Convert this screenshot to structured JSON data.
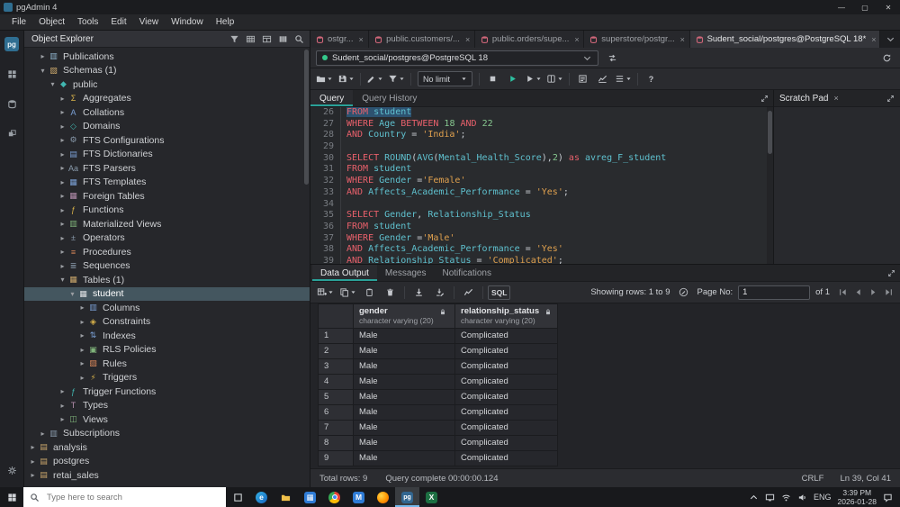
{
  "colors": {
    "accent": "#2aa198",
    "selection": "#2d5270",
    "keyword": "#e8606b",
    "identifier": "#5fc1cf",
    "string": "#dfa04e",
    "number": "#86c78f"
  },
  "titlebar": {
    "title": "pgAdmin 4",
    "minimize": "—",
    "maximize": "▢",
    "close": "✕"
  },
  "menubar": {
    "items": [
      "File",
      "Object",
      "Tools",
      "Edit",
      "View",
      "Window",
      "Help"
    ]
  },
  "iconstrip": {
    "top": [
      "pgadmin-logo",
      "dashboard-icon",
      "database-icon",
      "extensions-icon"
    ],
    "bottom": [
      "gear-icon"
    ]
  },
  "explorer": {
    "title": "Object Explorer",
    "tools": [
      "filter-icon",
      "grid-icon",
      "table-icon",
      "columns-icon",
      "search-icon"
    ],
    "tree": [
      {
        "label": "Publications",
        "level": 3,
        "state": "c",
        "glyph": "▥",
        "color": "#8fb4cc"
      },
      {
        "label": "Schemas (1)",
        "level": 3,
        "state": "e",
        "glyph": "▧",
        "color": "#c9a66b"
      },
      {
        "label": "public",
        "level": 4,
        "state": "e",
        "glyph": "◆",
        "color": "#41b6b0"
      },
      {
        "label": "Aggregates",
        "level": 5,
        "state": "c",
        "glyph": "Σ",
        "color": "#d8b24a"
      },
      {
        "label": "Collations",
        "level": 5,
        "state": "c",
        "glyph": "A",
        "color": "#7a9fd4"
      },
      {
        "label": "Domains",
        "level": 5,
        "state": "c",
        "glyph": "◇",
        "color": "#41b6b0"
      },
      {
        "label": "FTS Configurations",
        "level": 5,
        "state": "c",
        "glyph": "⚙",
        "color": "#8a9bac"
      },
      {
        "label": "FTS Dictionaries",
        "level": 5,
        "state": "c",
        "glyph": "▤",
        "color": "#7a9fd4"
      },
      {
        "label": "FTS Parsers",
        "level": 5,
        "state": "c",
        "glyph": "Aa",
        "color": "#8a9bac"
      },
      {
        "label": "FTS Templates",
        "level": 5,
        "state": "c",
        "glyph": "▦",
        "color": "#7a9fd4"
      },
      {
        "label": "Foreign Tables",
        "level": 5,
        "state": "c",
        "glyph": "▦",
        "color": "#b48ead"
      },
      {
        "label": "Functions",
        "level": 5,
        "state": "c",
        "glyph": "ƒ",
        "color": "#d8b24a"
      },
      {
        "label": "Materialized Views",
        "level": 5,
        "state": "c",
        "glyph": "▥",
        "color": "#7fb37a"
      },
      {
        "label": "Operators",
        "level": 5,
        "state": "c",
        "glyph": "±",
        "color": "#8a9bac"
      },
      {
        "label": "Procedures",
        "level": 5,
        "state": "c",
        "glyph": "≡",
        "color": "#d8875a"
      },
      {
        "label": "Sequences",
        "level": 5,
        "state": "c",
        "glyph": "≣",
        "color": "#8a9bac"
      },
      {
        "label": "Tables (1)",
        "level": 5,
        "state": "e",
        "glyph": "▦",
        "color": "#c9a66b"
      },
      {
        "label": "student",
        "level": 6,
        "state": "e",
        "glyph": "▦",
        "color": "#dde0e3",
        "selected": true
      },
      {
        "label": "Columns",
        "level": 7,
        "state": "c",
        "glyph": "▥",
        "color": "#7a9fd4"
      },
      {
        "label": "Constraints",
        "level": 7,
        "state": "c",
        "glyph": "◈",
        "color": "#d8b24a"
      },
      {
        "label": "Indexes",
        "level": 7,
        "state": "c",
        "glyph": "⇅",
        "color": "#7a9fd4"
      },
      {
        "label": "RLS Policies",
        "level": 7,
        "state": "c",
        "glyph": "▣",
        "color": "#7fb37a"
      },
      {
        "label": "Rules",
        "level": 7,
        "state": "c",
        "glyph": "▨",
        "color": "#d8875a"
      },
      {
        "label": "Triggers",
        "level": 7,
        "state": "c",
        "glyph": "⚡",
        "color": "#d8b24a"
      },
      {
        "label": "Trigger Functions",
        "level": 5,
        "state": "c",
        "glyph": "ƒ",
        "color": "#41b6b0"
      },
      {
        "label": "Types",
        "level": 5,
        "state": "c",
        "glyph": "T",
        "color": "#b48ead"
      },
      {
        "label": "Views",
        "level": 5,
        "state": "c",
        "glyph": "◫",
        "color": "#7fb37a"
      },
      {
        "label": "Subscriptions",
        "level": 3,
        "state": "c",
        "glyph": "▥",
        "color": "#8a9bac"
      },
      {
        "label": "analysis",
        "level": 2,
        "state": "c",
        "glyph": "▤",
        "color": "#c9a66b"
      },
      {
        "label": "postgres",
        "level": 2,
        "state": "c",
        "glyph": "▤",
        "color": "#c9a66b"
      },
      {
        "label": "retai_sales",
        "level": 2,
        "state": "c",
        "glyph": "▤",
        "color": "#c9a66b"
      }
    ]
  },
  "doc_tabs": {
    "tabs": [
      {
        "label": "ostgr...",
        "active": false
      },
      {
        "label": "public.customers/...",
        "active": false
      },
      {
        "label": "public.orders/supe...",
        "active": false
      },
      {
        "label": "superstore/postgr...",
        "active": false
      },
      {
        "label": "Sudent_social/postgres@PostgreSQL 18*",
        "active": true
      }
    ]
  },
  "connection": {
    "value": "Sudent_social/postgres@PostgreSQL 18"
  },
  "query_toolbar": {
    "limit_value": "No limit",
    "groups": [
      [
        {
          "i": "folder-icon",
          "c": 1
        },
        {
          "i": "save-icon",
          "c": 1
        }
      ],
      [
        {
          "i": "pencil-icon",
          "c": 1
        },
        {
          "i": "filter-icon",
          "c": 1
        }
      ],
      "LIMIT",
      [
        {
          "i": "stop-icon"
        },
        {
          "i": "play-icon",
          "a": 1
        },
        {
          "i": "play-icon",
          "c": 1
        },
        {
          "i": "pages-icon",
          "c": 1
        }
      ],
      [
        {
          "i": "explain-icon"
        },
        {
          "i": "explain-analyze-icon"
        },
        {
          "i": "list-icon",
          "c": 1
        }
      ],
      [
        {
          "i": "help-icon"
        }
      ]
    ]
  },
  "query_tabs": {
    "tabs": [
      {
        "label": "Query",
        "active": true
      },
      {
        "label": "Query History",
        "active": false
      }
    ]
  },
  "scratch_pad": {
    "title": "Scratch Pad",
    "close": "×"
  },
  "editor": {
    "lines": [
      {
        "n": 26,
        "t": [
          [
            "FROM",
            "k",
            1
          ],
          [
            " ",
            "p",
            1
          ],
          [
            "student",
            "i",
            1
          ]
        ]
      },
      {
        "n": 27,
        "t": [
          [
            "WHERE",
            "k"
          ],
          [
            " ",
            "p"
          ],
          [
            "Age",
            "i"
          ],
          [
            " ",
            "p"
          ],
          [
            "BETWEEN",
            "k"
          ],
          [
            " ",
            "p"
          ],
          [
            "18",
            "n"
          ],
          [
            " ",
            "p"
          ],
          [
            "AND",
            "k"
          ],
          [
            " ",
            "p"
          ],
          [
            "22",
            "n"
          ]
        ]
      },
      {
        "n": 28,
        "t": [
          [
            "AND",
            "k"
          ],
          [
            " ",
            "p"
          ],
          [
            "Country",
            "i"
          ],
          [
            " = ",
            "p"
          ],
          [
            "'India'",
            "s"
          ],
          [
            ";",
            "p"
          ]
        ]
      },
      {
        "n": 29,
        "t": []
      },
      {
        "n": 30,
        "t": [
          [
            "SELECT",
            "k"
          ],
          [
            " ",
            "p"
          ],
          [
            "ROUND",
            "i"
          ],
          [
            "(",
            "p"
          ],
          [
            "AVG",
            "i"
          ],
          [
            "(",
            "p"
          ],
          [
            "Mental_Health_Score",
            "i"
          ],
          [
            "),",
            "p"
          ],
          [
            "2",
            "n"
          ],
          [
            ")",
            "p"
          ],
          [
            " ",
            "p"
          ],
          [
            "as",
            "k"
          ],
          [
            " ",
            "p"
          ],
          [
            "avreg_F_student",
            "i"
          ]
        ]
      },
      {
        "n": 31,
        "t": [
          [
            "FROM",
            "k"
          ],
          [
            " ",
            "p"
          ],
          [
            "student",
            "i"
          ]
        ]
      },
      {
        "n": 32,
        "t": [
          [
            "WHERE",
            "k"
          ],
          [
            " ",
            "p"
          ],
          [
            "Gender",
            "i"
          ],
          [
            " =",
            "p"
          ],
          [
            "'Female'",
            "s"
          ]
        ]
      },
      {
        "n": 33,
        "t": [
          [
            "AND",
            "k"
          ],
          [
            " ",
            "p"
          ],
          [
            "Affects_Academic_Performance",
            "i"
          ],
          [
            " = ",
            "p"
          ],
          [
            "'Yes'",
            "s"
          ],
          [
            ";",
            "p"
          ]
        ]
      },
      {
        "n": 34,
        "t": []
      },
      {
        "n": 35,
        "t": [
          [
            "SELECT",
            "k"
          ],
          [
            " ",
            "p"
          ],
          [
            "Gender",
            "i"
          ],
          [
            ", ",
            "p"
          ],
          [
            "Relationship_Status",
            "i"
          ]
        ]
      },
      {
        "n": 36,
        "t": [
          [
            "FROM",
            "k"
          ],
          [
            " ",
            "p"
          ],
          [
            "student",
            "i"
          ]
        ]
      },
      {
        "n": 37,
        "t": [
          [
            "WHERE",
            "k"
          ],
          [
            " ",
            "p"
          ],
          [
            "Gender",
            "i"
          ],
          [
            " =",
            "p"
          ],
          [
            "'Male'",
            "s"
          ]
        ]
      },
      {
        "n": 38,
        "t": [
          [
            "AND",
            "k"
          ],
          [
            " ",
            "p"
          ],
          [
            "Affects_Academic_Performance",
            "i"
          ],
          [
            " = ",
            "p"
          ],
          [
            "'Yes'",
            "s"
          ]
        ]
      },
      {
        "n": 39,
        "t": [
          [
            "AND",
            "k"
          ],
          [
            " ",
            "p"
          ],
          [
            "Relationship_Status",
            "i"
          ],
          [
            " = ",
            "p"
          ],
          [
            "'Complicated'",
            "s"
          ],
          [
            ";",
            "p"
          ]
        ]
      }
    ]
  },
  "output": {
    "tabs": [
      {
        "label": "Data Output",
        "active": true
      },
      {
        "label": "Messages",
        "active": false
      },
      {
        "label": "Notifications",
        "active": false
      }
    ],
    "toolbar": [
      {
        "i": "add-row-icon",
        "c": 1
      },
      {
        "i": "copy-icon",
        "c": 1
      },
      {
        "i": "paste-icon"
      },
      {
        "i": "trash-icon"
      },
      "sep",
      {
        "i": "download-icon"
      },
      {
        "i": "download-edit-icon"
      },
      "sep",
      {
        "i": "chart-icon"
      },
      "sep",
      {
        "t": "SQL"
      }
    ],
    "toolbar_right": {
      "showing": "Showing rows: 1 to 9",
      "page_label": "Page No:",
      "page_value": "1",
      "of_label": "of 1"
    },
    "nav": [
      "nav-first-icon",
      "nav-prev-icon",
      "nav-next-icon",
      "nav-last-icon"
    ],
    "grid": {
      "columns": [
        {
          "name": "gender",
          "type": "character varying (20)"
        },
        {
          "name": "relationship_status",
          "type": "character varying (20)"
        }
      ],
      "rows": [
        [
          "Male",
          "Complicated"
        ],
        [
          "Male",
          "Complicated"
        ],
        [
          "Male",
          "Complicated"
        ],
        [
          "Male",
          "Complicated"
        ],
        [
          "Male",
          "Complicated"
        ],
        [
          "Male",
          "Complicated"
        ],
        [
          "Male",
          "Complicated"
        ],
        [
          "Male",
          "Complicated"
        ],
        [
          "Male",
          "Complicated"
        ]
      ]
    }
  },
  "statusbar": {
    "total_rows": "Total rows: 9",
    "query_complete": "Query complete 00:00:00.124",
    "eol": "CRLF",
    "position": "Ln 39, Col 41"
  },
  "taskbar": {
    "search_placeholder": "Type here to search",
    "apps": [
      {
        "name": "edge",
        "text": "e",
        "cls": "b-edge"
      },
      {
        "name": "file-explorer",
        "text": "",
        "cls": "b-folder"
      },
      {
        "name": "store",
        "text": "▦",
        "cls": "b-store"
      },
      {
        "name": "chrome",
        "text": "",
        "cls": "b-chrome"
      },
      {
        "name": "mail",
        "text": "M",
        "cls": "b-store"
      },
      {
        "name": "firefox",
        "text": "",
        "cls": "b-firefox"
      },
      {
        "name": "pgadmin",
        "text": "pg",
        "cls": "b-pg",
        "active": true
      },
      {
        "name": "excel",
        "text": "X",
        "cls": "b-excel"
      }
    ],
    "tray": {
      "lang": "ENG",
      "time": "3:39 PM",
      "date": "2026-01-28"
    }
  }
}
